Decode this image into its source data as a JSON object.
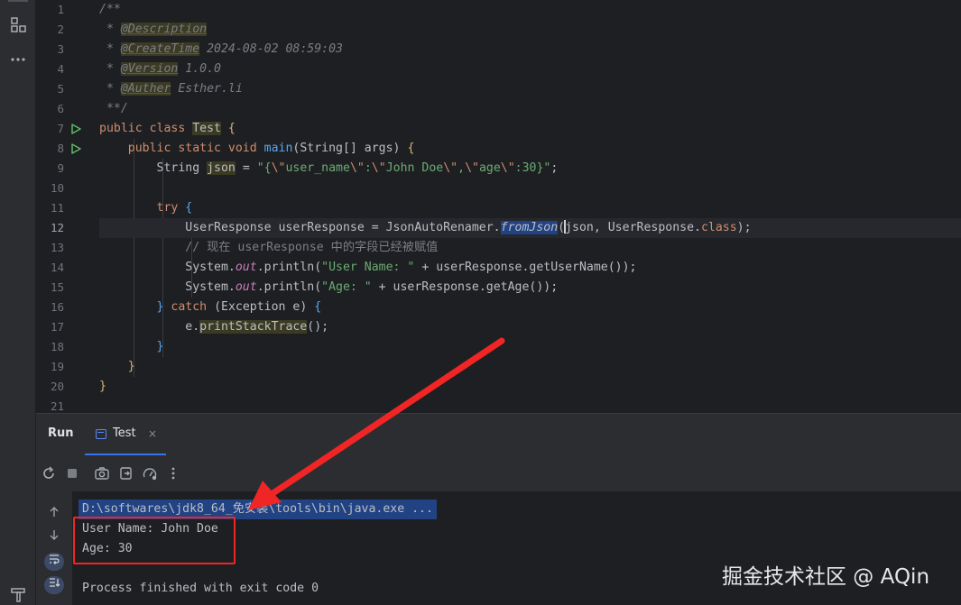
{
  "editor": {
    "line_numbers": [
      "1",
      "2",
      "3",
      "4",
      "5",
      "6",
      "7",
      "8",
      "9",
      "10",
      "11",
      "12",
      "13",
      "14",
      "15",
      "16",
      "17",
      "18",
      "19",
      "20",
      "21"
    ],
    "lines": {
      "l1": "/**",
      "l2_star": " * ",
      "l2_tag": "@Description",
      "l3_star": " * ",
      "l3_tag": "@CreateTime",
      "l3_text": " 2024-08-02 08:59:03",
      "l4_star": " * ",
      "l4_tag": "@Version",
      "l4_text": " 1.0.0",
      "l5_star": " * ",
      "l5_tag": "@Auther",
      "l5_text": " Esther.li",
      "l6": " **/",
      "l7_kw": "public class ",
      "l7_class": "Test",
      "l7_brace": " {",
      "l8_indent": "    ",
      "l8_kw": "public static void ",
      "l8_method": "main",
      "l8_rest": "(String[] args) ",
      "l8_brace": "{",
      "l9_indent": "        ",
      "l9_type": "String ",
      "l9_var": "json",
      "l9_eq": " = ",
      "l9_s1": "\"{",
      "l9_e1": "\\\"",
      "l9_s2": "user_name",
      "l9_e2": "\\\"",
      "l9_s3": ":",
      "l9_e3": "\\\"",
      "l9_s4": "John Doe",
      "l9_e4": "\\\"",
      "l9_s5": ",",
      "l9_e5": "\\\"",
      "l9_s6": "age",
      "l9_e6": "\\\"",
      "l9_s7": ":30}\"",
      "l9_end": ";",
      "l11_indent": "        ",
      "l11_kw": "try ",
      "l11_brace": "{",
      "l12_indent": "            ",
      "l12_a": "UserResponse userResponse = JsonAutoRenamer.",
      "l12_m": "fromJson",
      "l12_p": "(",
      "l12_b": "json, UserResponse.",
      "l12_kw": "class",
      "l12_c": ");",
      "l13_indent": "            ",
      "l13_cmt": "// 现在 userResponse 中的字段已经被赋值",
      "l14_indent": "            ",
      "l14_a": "System.",
      "l14_out": "out",
      "l14_b": ".println(",
      "l14_s": "\"User Name: \"",
      "l14_c": " + userResponse.getUserName());",
      "l15_indent": "            ",
      "l15_a": "System.",
      "l15_out": "out",
      "l15_b": ".println(",
      "l15_s": "\"Age: \"",
      "l15_c": " + userResponse.getAge());",
      "l16_indent": "        ",
      "l16_brace": "} ",
      "l16_kw": "catch ",
      "l16_rest": "(Exception e) ",
      "l16_brace2": "{",
      "l17_indent": "            ",
      "l17_a": "e.",
      "l17_m": "printStackTrace",
      "l17_b": "();",
      "l18_indent": "        ",
      "l18_brace": "}",
      "l19_indent": "    ",
      "l19_brace": "}",
      "l20_brace": "}"
    }
  },
  "run_panel": {
    "title": "Run",
    "tab_label": "Test",
    "tab_close": "×"
  },
  "console": {
    "cmd": "D:\\softwares\\jdk8_64_免安装\\tools\\bin\\java.exe ...",
    "line1": "User Name: John Doe",
    "line2": "Age: 30",
    "line3": "Process finished with exit code 0"
  },
  "watermark": "掘金技术社区 @ AQin",
  "icons": {
    "sidebar_structure": "structure-icon",
    "sidebar_more": "more-icon",
    "sidebar_bottom": "hammer-icon"
  },
  "colors": {
    "annotation_red": "#f02525",
    "accent_blue": "#3574f0"
  }
}
